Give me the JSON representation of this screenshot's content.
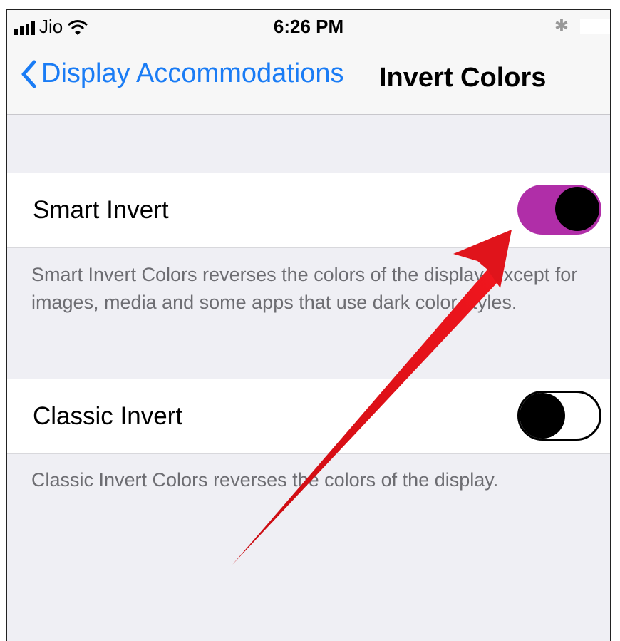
{
  "status_bar": {
    "carrier": "Jio",
    "time": "6:26 PM"
  },
  "nav": {
    "back_label": "Display Accommodations",
    "title": "Invert Colors"
  },
  "settings": {
    "smart_invert": {
      "label": "Smart Invert",
      "enabled": true,
      "description": "Smart Invert Colors reverses the colors of the display, except for images, media and some apps that use dark color styles."
    },
    "classic_invert": {
      "label": "Classic Invert",
      "enabled": false,
      "description": "Classic Invert Colors reverses the colors of the display."
    }
  },
  "colors": {
    "accent_blue": "#1a7cf5",
    "toggle_on": "#b02ea8",
    "annotation_arrow": "#e0141b"
  },
  "icons": [
    "signal-icon",
    "wifi-icon",
    "bluetooth-icon",
    "battery-icon",
    "chevron-left-icon"
  ]
}
